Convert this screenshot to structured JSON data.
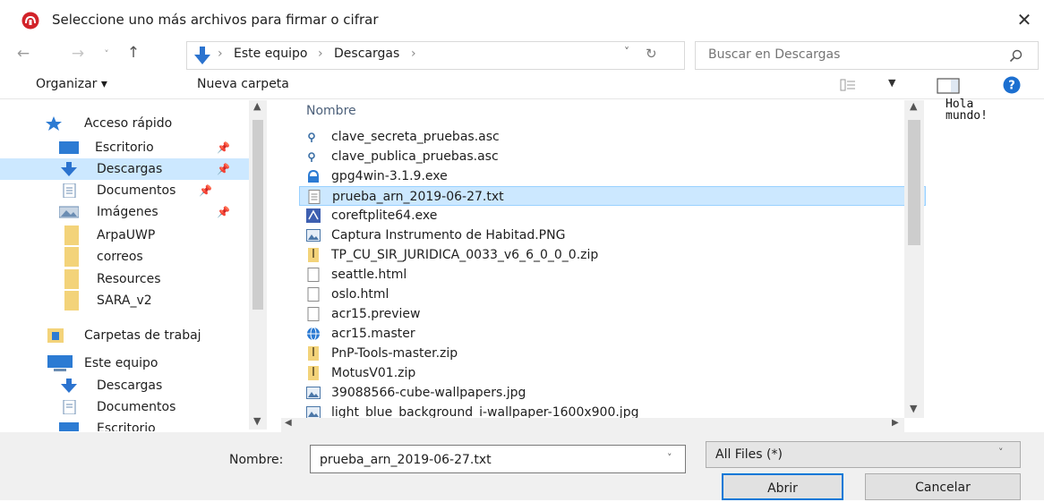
{
  "dialog": {
    "title": "Seleccione uno más archivos para firmar o cifrar",
    "close_glyph": "✕"
  },
  "address_bar": {
    "crumbs": [
      "Este equipo",
      "Descargas"
    ],
    "separator": "›",
    "back_icon": "arrow-left-icon",
    "forward_icon": "arrow-right-icon",
    "up_icon": "arrow-up-icon"
  },
  "search": {
    "placeholder": "Buscar en Descargas"
  },
  "toolbar": {
    "organize_label": "Organizar ▾",
    "new_folder_label": "Nueva carpeta"
  },
  "nav_pane": {
    "items": [
      {
        "label": "Acceso rápido",
        "icon": "star-icon",
        "pinned": false,
        "selected": false
      },
      {
        "label": "Escritorio",
        "icon": "desktop-icon",
        "pinned": true,
        "selected": false
      },
      {
        "label": "Descargas",
        "icon": "download-icon",
        "pinned": true,
        "selected": true
      },
      {
        "label": "Documentos",
        "icon": "document-icon",
        "pinned": true,
        "selected": false
      },
      {
        "label": "Imágenes",
        "icon": "pictures-icon",
        "pinned": true,
        "selected": false
      },
      {
        "label": "ArpaUWP",
        "icon": "folder-icon",
        "pinned": false,
        "selected": false
      },
      {
        "label": "correos",
        "icon": "folder-icon",
        "pinned": false,
        "selected": false
      },
      {
        "label": "Resources",
        "icon": "folder-icon",
        "pinned": false,
        "selected": false
      },
      {
        "label": "SARA_v2",
        "icon": "folder-icon",
        "pinned": false,
        "selected": false
      },
      {
        "label": "Carpetas de trabaj",
        "icon": "work-folders-icon",
        "pinned": false,
        "selected": false
      },
      {
        "label": "Este equipo",
        "icon": "computer-icon",
        "pinned": false,
        "selected": false
      },
      {
        "label": "Descargas",
        "icon": "download-icon",
        "pinned": false,
        "selected": false
      },
      {
        "label": "Documentos",
        "icon": "document-icon",
        "pinned": false,
        "selected": false
      },
      {
        "label": "Escritorio",
        "icon": "desktop-icon",
        "pinned": false,
        "selected": false
      }
    ]
  },
  "file_list": {
    "column_header": "Nombre",
    "files": [
      {
        "name": "clave_secreta_pruebas.asc",
        "icon": "key-file-icon",
        "selected": false
      },
      {
        "name": "clave_publica_pruebas.asc",
        "icon": "key-file-icon",
        "selected": false
      },
      {
        "name": "gpg4win-3.1.9.exe",
        "icon": "installer-icon",
        "selected": false
      },
      {
        "name": "prueba_arn_2019-06-27.txt",
        "icon": "text-file-icon",
        "selected": true
      },
      {
        "name": "coreftplite64.exe",
        "icon": "app-exe-icon",
        "selected": false
      },
      {
        "name": "Captura Instrumento de Habitad.PNG",
        "icon": "image-file-icon",
        "selected": false
      },
      {
        "name": "TP_CU_SIR_JURIDICA_0033_v6_6_0_0_0.zip",
        "icon": "zip-file-icon",
        "selected": false
      },
      {
        "name": "seattle.html",
        "icon": "blank-file-icon",
        "selected": false
      },
      {
        "name": "oslo.html",
        "icon": "blank-file-icon",
        "selected": false
      },
      {
        "name": "acr15.preview",
        "icon": "blank-file-icon",
        "selected": false
      },
      {
        "name": "acr15.master",
        "icon": "globe-file-icon",
        "selected": false
      },
      {
        "name": "PnP-Tools-master.zip",
        "icon": "zip-file-icon",
        "selected": false
      },
      {
        "name": "MotusV01.zip",
        "icon": "zip-file-icon",
        "selected": false
      },
      {
        "name": "39088566-cube-wallpapers.jpg",
        "icon": "image-file-icon",
        "selected": false
      },
      {
        "name": "light_blue_background_i-wallpaper-1600x900.jpg",
        "icon": "image-file-icon",
        "selected": false
      }
    ]
  },
  "preview": {
    "text": "Hola\nmundo!"
  },
  "footer": {
    "filename_label": "Nombre:",
    "filename_value": "prueba_arn_2019-06-27.txt",
    "filter_value": "All Files (*)",
    "open_label": "Abrir",
    "cancel_label": "Cancelar"
  },
  "colors": {
    "accent": "#0078d7",
    "selection_bg": "#cce8ff",
    "selection_border": "#99d1ff",
    "footer_bg": "#f0f0f0"
  }
}
